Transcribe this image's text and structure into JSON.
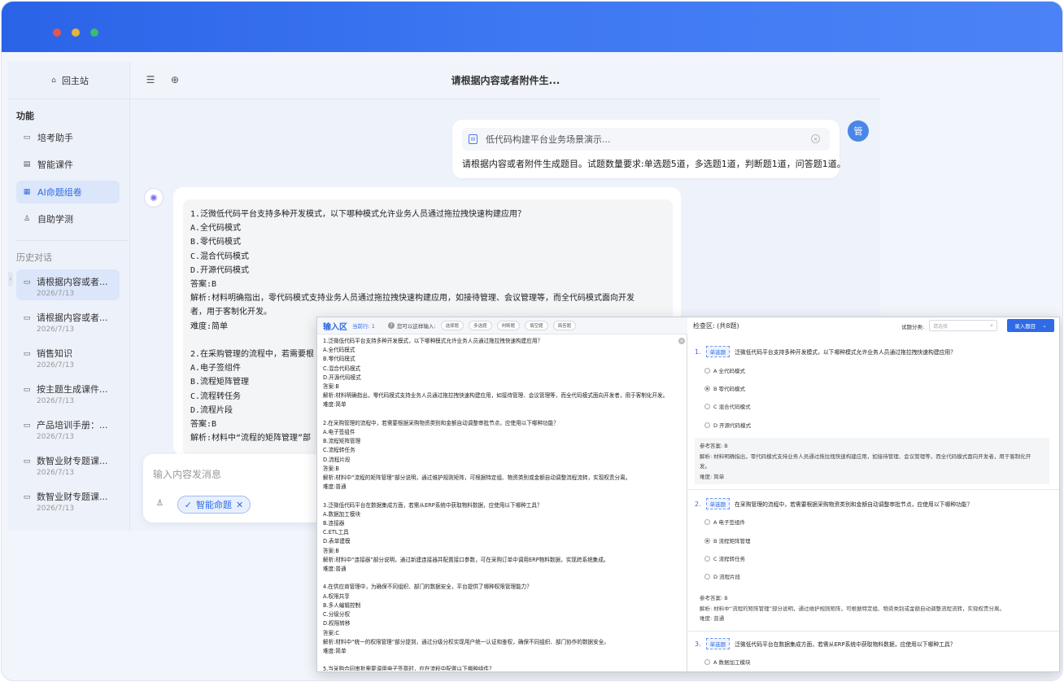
{
  "sidebar": {
    "home": "回主站",
    "features_title": "功能",
    "features": [
      {
        "label": "培考助手",
        "icon": "chat-icon"
      },
      {
        "label": "智能课件",
        "icon": "file-icon"
      },
      {
        "label": "AI命题组卷",
        "icon": "document-icon"
      },
      {
        "label": "自助学测",
        "icon": "user-icon"
      }
    ],
    "history_title": "历史对话",
    "history": [
      {
        "title": "请根据内容或者...",
        "date": "2026/7/13"
      },
      {
        "title": "请根据内容或者...",
        "date": "2026/7/13"
      },
      {
        "title": "销售知识",
        "date": "2026/7/13"
      },
      {
        "title": "按主题生成课件...",
        "date": "2026/7/13"
      },
      {
        "title": "产品培训手册：...",
        "date": "2026/7/13"
      },
      {
        "title": "数智业财专题课...",
        "date": "2026/7/13"
      },
      {
        "title": "数智业财专题课...",
        "date": "2026/7/13"
      }
    ]
  },
  "header": {
    "title": "请根据内容或者附件生..."
  },
  "user_message": {
    "attachment": "低代码构建平台业务场景演示...",
    "avatar": "管",
    "text": "请根据内容或者附件生成题目。试题数量要求:单选题5道，多选题1道，判断题1道，问答题1道。"
  },
  "bot_message": {
    "lines": [
      "1.泛微低代码平台支持多种开发模式，以下哪种模式允许业务人员通过拖拉拽快速构建应用？",
      "A.全代码模式",
      "B.零代码模式",
      "C.混合代码模式",
      "D.开源代码模式",
      "答案:B",
      "解析:材料明确指出，零代码模式支持业务人员通过拖拉拽快速构建应用，如接待管理、会议管理等，而全代码模式面向开发",
      "者，用于客制化开发。",
      "难度:简单",
      "",
      "2.在采购管理的流程中，若需要根",
      "A.电子签组件",
      "B.流程矩阵管理",
      "C.流程转任务",
      "D.流程片段",
      "答案:B",
      "解析:材料中“流程的矩阵管理”部"
    ]
  },
  "composer": {
    "placeholder": "输入内容发消息",
    "chip_label": "智能命题"
  },
  "overlay": {
    "input_area_title": "输入区",
    "current_row": "当前行: 1",
    "hint": "您可以这样输入:",
    "type_buttons": [
      "选择题",
      "多选题",
      "判断题",
      "填空题",
      "简答题"
    ],
    "input_lines": [
      "1.泛微低代码平台支持多种开发模式，以下哪种模式允许业务人员通过拖拉拽快速构建应用？",
      "A.全代码模式",
      "B.零代码模式",
      "C.混合代码模式",
      "D.开源代码模式",
      "答案:B",
      "解析:材料明确指出，零代码模式支持业务人员通过拖拉拽快速构建应用，如接待管理、会议管理等，而全代码模式面向开发者，用于客制化开发。",
      "难度:简单",
      "",
      "2.在采购管理的流程中，若需要根据采购物资类别和金额自动调整审批节点，应使用以下哪种功能？",
      "A.电子签组件",
      "B.流程矩阵管理",
      "C.流程转任务",
      "D.流程片段",
      "答案:B",
      "解析:材料中“流程的矩阵管理”部分说明，通过维护规则矩阵，可根据特定组、物资类别或金额自动调整流程流转，实现权责分离。",
      "难度:普通",
      "",
      "3.泛微低代码平台在数据集成方面，若需从ERP系统中获取物料数据，应使用以下哪种工具？",
      "A.数据加工模块",
      "B.连接器",
      "C.ETL工具",
      "D.表单建模",
      "答案:B",
      "解析:材料中“连接器”部分说明，通过新建连接器并配置接口参数，可在采购订单中调用ERP物料数据，实现跨系统集成。",
      "难度:普通",
      "",
      "4.在供应商管理中，为确保不同组织、部门的数据安全，平台提供了哪种权限管理能力？",
      "A.权限共享",
      "B.多人编辑控制",
      "C.分级分权",
      "D.权限转移",
      "答案:C",
      "解析:材料中“统一的权限管理”部分提到，通过分级分权实现用户统一认证和鉴权，确保不同组织、部门协作的数据安全。",
      "难度:简单",
      "",
      "5.当采购合同审批需要调用电子签章时，应在流程中配置以下哪种组件？"
    ],
    "check_title": "检查区: (共8题)",
    "category_label": "试题分类:",
    "category_placeholder": "请选择",
    "enter_button": "录入题目",
    "questions": [
      {
        "num": "1.",
        "type": "单选题",
        "stem": "泛微低代码平台支持多种开发模式，以下哪种模式允许业务人员通过拖拉拽快速构建应用？",
        "options": [
          "A 全代码模式",
          "B 零代码模式",
          "C 混合代码模式",
          "D 开源代码模式"
        ],
        "selected": 1,
        "ref_answer": "参考答案: B",
        "analysis": "解析: 材料明确指出，零代码模式支持业务人员通过拖拉拽快速构建应用，如接待管理、会议管理等，而全代码模式面向开发者，用于客制化开",
        "analysis2": "发。",
        "difficulty": "难度: 简单"
      },
      {
        "num": "2.",
        "type": "单选题",
        "stem": "在采购管理的流程中，若需要根据采购物资类别和金额自动调整审批节点，应使用以下哪种功能？",
        "options": [
          "A 电子签组件",
          "B 流程矩阵管理",
          "C 流程转任务",
          "D 流程片段"
        ],
        "selected": 1,
        "ref_answer": "参考答案: B",
        "analysis": "解析: 材料中“流程的矩阵管理”部分说明，通过维护规则矩阵，可根据特定组、物资类别或金额自动调整流程流转，实现权责分离。",
        "difficulty": "难度: 普通"
      },
      {
        "num": "3.",
        "type": "单选题",
        "stem": "泛微低代码平台在数据集成方面，若需从ERP系统中获取物料数据，应使用以下哪种工具？",
        "options": [
          "A 数据加工模块"
        ]
      }
    ]
  }
}
